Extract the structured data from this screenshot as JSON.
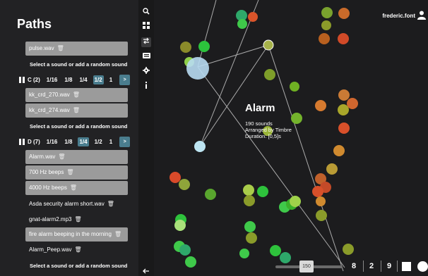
{
  "panel": {
    "title": "Paths",
    "sounds_top": [
      {
        "label": "pulse.wav",
        "selected": true
      }
    ],
    "hint": "Select a sound or add a random sound",
    "rows": [
      {
        "label": "C (2)",
        "rates": [
          "1/16",
          "1/8",
          "1/4",
          "1/2",
          "1"
        ],
        "active_rate": "1/2",
        "go": ">",
        "sounds": [
          {
            "label": "kk_crd_270.wav",
            "selected": true
          },
          {
            "label": "kk_crd_274.wav",
            "selected": true
          }
        ]
      },
      {
        "label": "D (7)",
        "rates": [
          "1/16",
          "1/8",
          "1/4",
          "1/2",
          "1"
        ],
        "active_rate": "1/4",
        "go": ">",
        "sounds": [
          {
            "label": "Alarm.wav",
            "selected": true
          },
          {
            "label": "700 Hz beeps",
            "selected": true
          },
          {
            "label": "4000 Hz beeps",
            "selected": true
          },
          {
            "label": "Asda security alarm short.wav",
            "selected": false
          },
          {
            "label": "gnat-alarm2.mp3",
            "selected": false
          },
          {
            "label": "fire alarm beeping in the morning",
            "selected": true
          },
          {
            "label": "Alarm_Peep.wav",
            "selected": false
          }
        ]
      }
    ]
  },
  "strip_icons": [
    "search-icon",
    "grid-icon",
    "swap-icon",
    "keyboard-icon",
    "gear-icon",
    "info-icon",
    "back-arrow-icon"
  ],
  "map": {
    "user_name": "frederic.font",
    "title": "Alarm",
    "sub1": "190 sounds",
    "sub2": "Arranged by Timbre",
    "sub3": "Duration: [0,5]s",
    "slider_value": "150",
    "counts": [
      "8",
      "2",
      "9"
    ]
  },
  "colors": {
    "accent": "#4a7d8e",
    "selected_sound": "#9b9b9b"
  }
}
